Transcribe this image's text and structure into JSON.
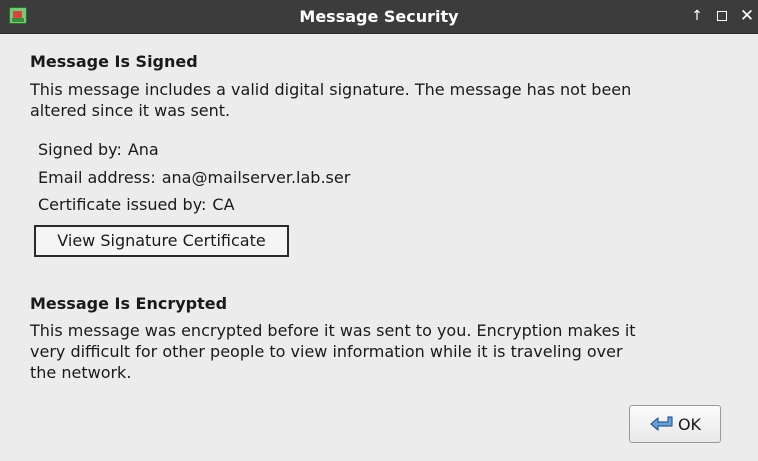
{
  "window": {
    "title": "Message Security",
    "controls": {
      "keep_above": "↑",
      "maximize": "□",
      "close": "✕"
    }
  },
  "signed": {
    "heading": "Message Is Signed",
    "description_line1": "This message includes a valid digital signature. The message has not been",
    "description_line2": "altered since it was sent.",
    "signed_by_label": "Signed by:",
    "signed_by_value": "Ana",
    "email_label": "Email address:",
    "email_value": "ana@mailserver.lab.ser",
    "issuer_label": "Certificate issued by:",
    "issuer_value": "CA",
    "view_cert_button": "View Signature Certificate"
  },
  "encrypted": {
    "heading": "Message Is Encrypted",
    "description_line1": "This message was encrypted before it was sent to you. Encryption makes it",
    "description_line2": "very difficult for other people to view information while it is traveling over",
    "description_line3": "the network."
  },
  "footer": {
    "ok_label": "OK",
    "ok_icon": "enter-arrow-icon"
  }
}
